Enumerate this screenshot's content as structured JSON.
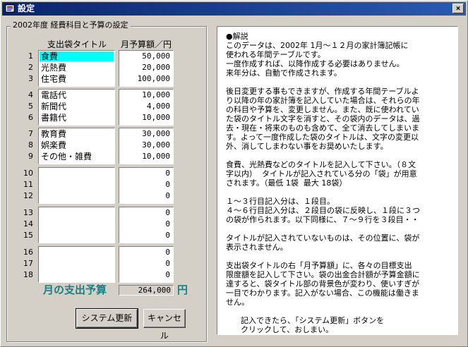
{
  "window": {
    "title": "設定",
    "close_label": "×"
  },
  "group": {
    "legend": "2002年度  経費科目と予算の設定"
  },
  "columns": {
    "title_header": "支出袋タイトル",
    "amount_header": "月予算額／円"
  },
  "rows": [
    {
      "num": "1",
      "title": "食費",
      "amount": "50,000"
    },
    {
      "num": "2",
      "title": "光熱費",
      "amount": "20,000"
    },
    {
      "num": "3",
      "title": "住宅費",
      "amount": "100,000"
    },
    {
      "num": "4",
      "title": "電話代",
      "amount": "10,000"
    },
    {
      "num": "5",
      "title": "新聞代",
      "amount": "4,000"
    },
    {
      "num": "6",
      "title": "書籍代",
      "amount": "10,000"
    },
    {
      "num": "7",
      "title": "教育費",
      "amount": "30,000"
    },
    {
      "num": "8",
      "title": "娯楽費",
      "amount": "30,000"
    },
    {
      "num": "9",
      "title": "その他・雑費",
      "amount": "10,000"
    },
    {
      "num": "10",
      "title": "",
      "amount": "0"
    },
    {
      "num": "11",
      "title": "",
      "amount": "0"
    },
    {
      "num": "12",
      "title": "",
      "amount": "0"
    },
    {
      "num": "13",
      "title": "",
      "amount": "0"
    },
    {
      "num": "14",
      "title": "",
      "amount": "0"
    },
    {
      "num": "15",
      "title": "",
      "amount": "0"
    },
    {
      "num": "16",
      "title": "",
      "amount": "0"
    },
    {
      "num": "17",
      "title": "",
      "amount": "0"
    },
    {
      "num": "18",
      "title": "",
      "amount": "0"
    }
  ],
  "selected_row": 0,
  "total": {
    "label": "月の支出予算",
    "value": "264,000",
    "unit": "円"
  },
  "buttons": {
    "update": "システム更新",
    "cancel": "キャンセル"
  },
  "note": {
    "text": "●解説\nこのデータは、2002年 1月～１２月の家計簿記帳に\n使われる年間テーブルです。\n一度作成すれば、以降作成する必要はありません。\n来年分は、自動で作成されます。\n\n後日変更する事もできますが、作成する年間テーブルよ\nり以降の年の家計簿を記入していた場合は、それらの年\nの科目や予算を、変更しません。また、既に使われてい\nた袋のタイトル文字を消すと、その袋内のデータは、過\n去・現在・将来のものも含めて、全て消去してしまいま\nす。よって一度作成した袋のタイトルは、文字の変更以\n外、消してしまわない事をお奨めいたします。\n\n食費、光熱費などのタイトルを記入して下さい。（８文\n字以内）  タイトルが記入されている分の「袋」が用意\nされます。（最低 1袋  最大 18袋）\n\n１～３行目記入分は、１段目。\n４～６行目記入分は、２段目の袋に反映し、１段に３つ\nの袋が作られます。以下同様に、７～９行を３段目・・\n\nタイトルが記入されていないものは、その位置に、袋が\n表示されません。\n\n支出袋タイトルの右「月予算額」に、各々の目標支出\n限度額を記入して下さい。袋の出金合計額が予算金額に\n達すると、袋タイトル部の背景色が変わり、使いすぎが\n一目でわかります。記入がない場合、この機能は働きま\nせん。\n\n      記入できたら、「システム更新」ボタンを\n      クリックして、おしまい。"
  },
  "colors": {
    "titlebar": "#0a246a",
    "selected_cell": "#00ffff",
    "total_text": "#1e7e82"
  }
}
